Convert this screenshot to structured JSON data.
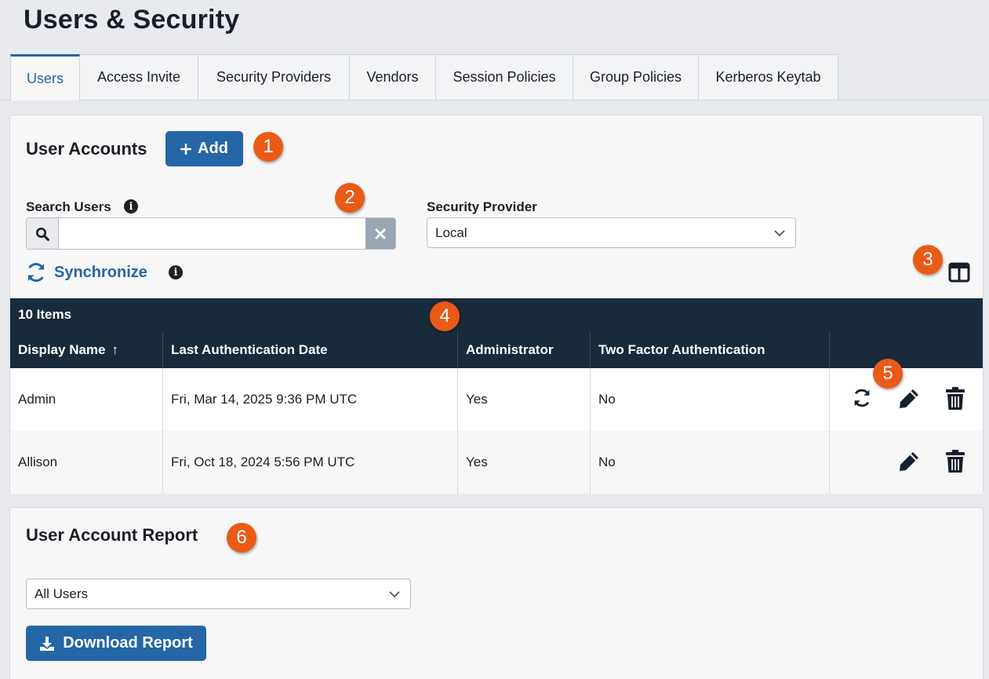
{
  "page": {
    "title": "Users & Security"
  },
  "tabs": [
    {
      "label": "Users",
      "active": true
    },
    {
      "label": "Access Invite"
    },
    {
      "label": "Security Providers"
    },
    {
      "label": "Vendors"
    },
    {
      "label": "Session Policies"
    },
    {
      "label": "Group Policies"
    },
    {
      "label": "Kerberos Keytab"
    }
  ],
  "accounts": {
    "title": "User Accounts",
    "add_label": "Add",
    "search": {
      "label": "Search Users",
      "value": "",
      "placeholder": ""
    },
    "provider": {
      "label": "Security Provider",
      "selected": "Local"
    },
    "sync_label": "Synchronize",
    "table": {
      "count_label": "10 Items",
      "columns": [
        "Display Name",
        "Last Authentication Date",
        "Administrator",
        "Two Factor Authentication",
        ""
      ],
      "sort_indicator": "↑",
      "rows": [
        {
          "name": "Admin",
          "last_auth": "Fri, Mar 14, 2025 9:36 PM UTC",
          "admin": "Yes",
          "two_factor": "No",
          "sync_action": true
        },
        {
          "name": "Allison",
          "last_auth": "Fri, Oct 18, 2024 5:56 PM UTC",
          "admin": "Yes",
          "two_factor": "No",
          "sync_action": false
        }
      ]
    }
  },
  "report": {
    "title": "User Account Report",
    "filter_selected": "All Users",
    "download_label": "Download Report"
  },
  "callouts": [
    "1",
    "2",
    "3",
    "4",
    "5",
    "6"
  ],
  "colors": {
    "accent": "#2466a6",
    "table_header": "#192a3b",
    "callout": "#ea5a17"
  }
}
